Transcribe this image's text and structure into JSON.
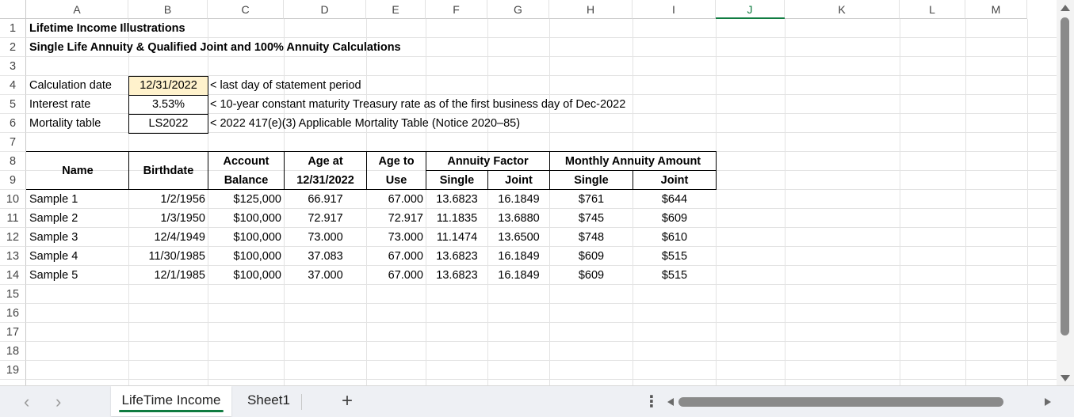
{
  "column_headers": [
    "A",
    "B",
    "C",
    "D",
    "E",
    "F",
    "G",
    "H",
    "I",
    "J",
    "K",
    "L",
    "M"
  ],
  "selected_column": "J",
  "row_headers": [
    "1",
    "2",
    "3",
    "4",
    "5",
    "6",
    "7",
    "8",
    "9",
    "10",
    "11",
    "12",
    "13",
    "14",
    "15",
    "16",
    "17",
    "18",
    "19"
  ],
  "title": "Lifetime Income Illustrations",
  "subtitle": "Single Life Annuity & Qualified Joint and 100% Annuity Calculations",
  "params": {
    "calc_label": "Calculation date",
    "calc_value": "12/31/2022",
    "calc_note": "< last day of statement period",
    "rate_label": "Interest rate",
    "rate_value": "3.53%",
    "rate_note": "< 10-year constant maturity Treasury rate as of the first business day of Dec-2022",
    "mort_label": "Mortality table",
    "mort_value": "LS2022",
    "mort_note": "< 2022 417(e)(3) Applicable Mortality Table (Notice 2020–85)"
  },
  "table_headers": {
    "name": "Name",
    "birthdate": "Birthdate",
    "account": "Account",
    "balance": "Balance",
    "age_at": "Age at",
    "age_at_date": "12/31/2022",
    "age_to": "Age to",
    "use": "Use",
    "annuity_factor": "Annuity Factor",
    "monthly_amount": "Monthly Annuity Amount",
    "single": "Single",
    "joint": "Joint"
  },
  "rows": [
    {
      "name": "Sample 1",
      "birthdate": "1/2/1956",
      "balance": "$125,000",
      "age_at": "66.917",
      "age_to": "67.000",
      "factor_single": "13.6823",
      "factor_joint": "16.1849",
      "amount_single": "$761",
      "amount_joint": "$644"
    },
    {
      "name": "Sample 2",
      "birthdate": "1/3/1950",
      "balance": "$100,000",
      "age_at": "72.917",
      "age_to": "72.917",
      "factor_single": "11.1835",
      "factor_joint": "13.6880",
      "amount_single": "$745",
      "amount_joint": "$609"
    },
    {
      "name": "Sample 3",
      "birthdate": "12/4/1949",
      "balance": "$100,000",
      "age_at": "73.000",
      "age_to": "73.000",
      "factor_single": "11.1474",
      "factor_joint": "13.6500",
      "amount_single": "$748",
      "amount_joint": "$610"
    },
    {
      "name": "Sample 4",
      "birthdate": "11/30/1985",
      "balance": "$100,000",
      "age_at": "37.083",
      "age_to": "67.000",
      "factor_single": "13.6823",
      "factor_joint": "16.1849",
      "amount_single": "$609",
      "amount_joint": "$515"
    },
    {
      "name": "Sample 5",
      "birthdate": "12/1/1985",
      "balance": "$100,000",
      "age_at": "37.000",
      "age_to": "67.000",
      "factor_single": "13.6823",
      "factor_joint": "16.1849",
      "amount_single": "$609",
      "amount_joint": "$515"
    }
  ],
  "tabs": [
    {
      "label": "LifeTime Income",
      "active": true
    },
    {
      "label": "Sheet1",
      "active": false
    }
  ],
  "icons": {
    "prev": "chevron-left-icon",
    "next": "chevron-right-icon",
    "add": "plus-icon",
    "more": "more-options-icon"
  },
  "nav": {
    "prev_glyph": "‹",
    "next_glyph": "›",
    "add_glyph": "+",
    "more_glyph": "⋮"
  },
  "colors": {
    "accent": "#107c41",
    "input_highlight": "#fff2cc"
  }
}
